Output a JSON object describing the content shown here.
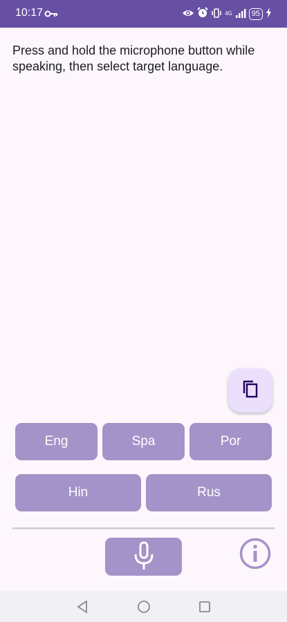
{
  "status_bar": {
    "time": "10:17",
    "network_label": "4G",
    "battery_level": "95",
    "icons": [
      "key-icon",
      "eye-icon",
      "alarm-icon",
      "vibrate-icon",
      "signal-icon",
      "charging-icon"
    ]
  },
  "main": {
    "instructions": "Press and hold the microphone button while speaking, then select target language."
  },
  "language_buttons": {
    "row1": [
      "Eng",
      "Spa",
      "Por"
    ],
    "row2": [
      "Hin",
      "Rus"
    ]
  },
  "colors": {
    "status_bar": "#6750a4",
    "background": "#fdf7fd",
    "button": "#a393c8",
    "fab": "#ebe0fb",
    "icon_dark": "#21005d"
  }
}
